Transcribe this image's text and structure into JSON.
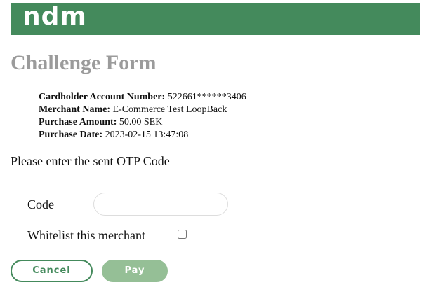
{
  "header": {
    "logo_text": "ndm",
    "bar_color": "#448a5c"
  },
  "page_title": "Challenge Form",
  "details": {
    "account_label": "Cardholder Account Number:",
    "account_value": "522661******3406",
    "merchant_label": "Merchant Name:",
    "merchant_value": "E-Commerce Test LoopBack",
    "amount_label": "Purchase Amount:",
    "amount_value": "50.00 SEK",
    "date_label": "Purchase Date:",
    "date_value": "2023-02-15 13:47:08"
  },
  "instruction": "Please enter the sent OTP Code",
  "form": {
    "code_label": "Code",
    "code_value": "",
    "code_placeholder": "",
    "whitelist_label": "Whitelist this merchant",
    "whitelist_checked": false
  },
  "buttons": {
    "cancel_label": "Cancel",
    "pay_label": "Pay"
  },
  "colors": {
    "accent": "#448a5c",
    "pay_button": "#95bf96",
    "title": "#9b9b9b"
  }
}
